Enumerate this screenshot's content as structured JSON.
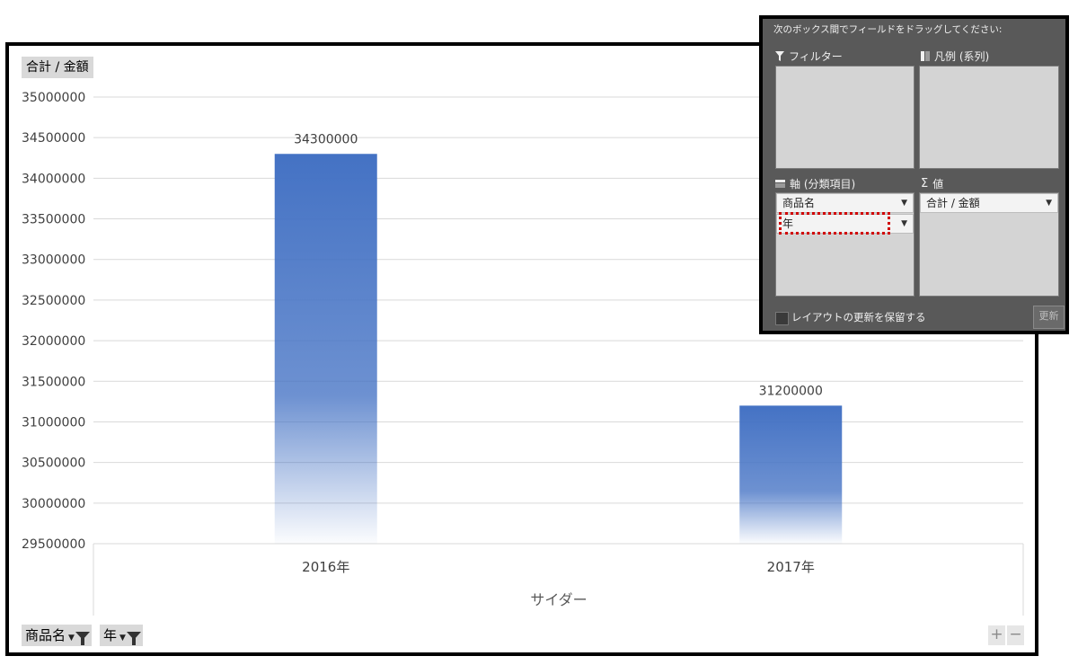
{
  "chart": {
    "value_field_button": "合計 / 金額",
    "axis_field_buttons": [
      "商品名",
      "年"
    ]
  },
  "chart_data": {
    "type": "bar",
    "categories": [
      "2016年",
      "2017年"
    ],
    "series": [
      {
        "values": [
          34300000,
          31200000
        ]
      }
    ],
    "data_labels": [
      "34300000",
      "31200000"
    ],
    "xlabel": "サイダー",
    "ylabel": "",
    "ylim": [
      29500000,
      35000000
    ],
    "yticks": [
      29500000,
      30000000,
      30500000,
      31000000,
      31500000,
      32000000,
      32500000,
      33000000,
      33500000,
      34000000,
      34500000,
      35000000
    ],
    "bar_color": "#4472c4",
    "grid": true
  },
  "zoom": {
    "plus": "+",
    "minus": "−"
  },
  "field_panel": {
    "instruction": "次のボックス間でフィールドをドラッグしてください:",
    "filters_label": "フィルター",
    "legend_label": "凡例 (系列)",
    "axis_label": "軸 (分類項目)",
    "values_label": "値",
    "axis_fields": [
      "商品名",
      "年"
    ],
    "value_fields": [
      "合計 / 金額"
    ],
    "defer_label": "レイアウトの更新を保留する",
    "update_label": "更新",
    "icons": {
      "filter": "funnel-icon",
      "legend": "columns-icon",
      "axis": "rows-icon",
      "values": "sigma-icon"
    }
  }
}
